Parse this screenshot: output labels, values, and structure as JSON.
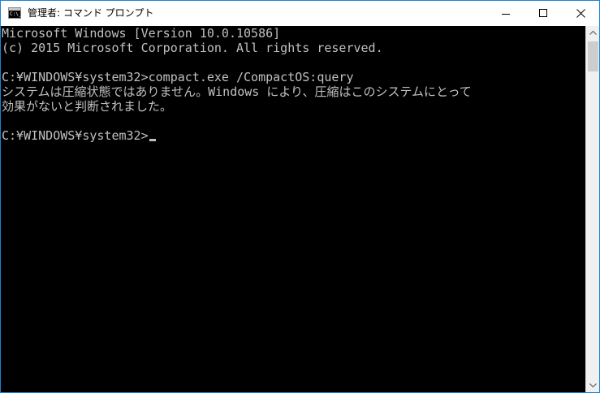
{
  "window": {
    "title": "管理者: コマンド プロンプト",
    "icon": "cmd-app-icon",
    "icon_glyph": "C:\\_"
  },
  "caption_buttons": {
    "minimize_icon": "minimize-icon",
    "maximize_icon": "maximize-icon",
    "close_icon": "close-icon"
  },
  "console": {
    "lines": [
      "Microsoft Windows [Version 10.0.10586]",
      "(c) 2015 Microsoft Corporation. All rights reserved.",
      "",
      "C:¥WINDOWS¥system32>compact.exe /CompactOS:query",
      "システムは圧縮状態ではありません。Windows により、圧縮はこのシステムにとって",
      "効果がないと判断されました。",
      ""
    ],
    "prompt": "C:¥WINDOWS¥system32>",
    "text_color": "#c0c0c0",
    "background_color": "#000000"
  },
  "scrollbar": {
    "up_icon": "scroll-up-arrow-icon",
    "down_icon": "scroll-down-arrow-icon"
  },
  "colors": {
    "window_border": "#1883d7",
    "titlebar_bg": "#ffffff",
    "scrollbar_bg": "#f0f0f0",
    "scrollbar_thumb": "#cdcdcd"
  }
}
